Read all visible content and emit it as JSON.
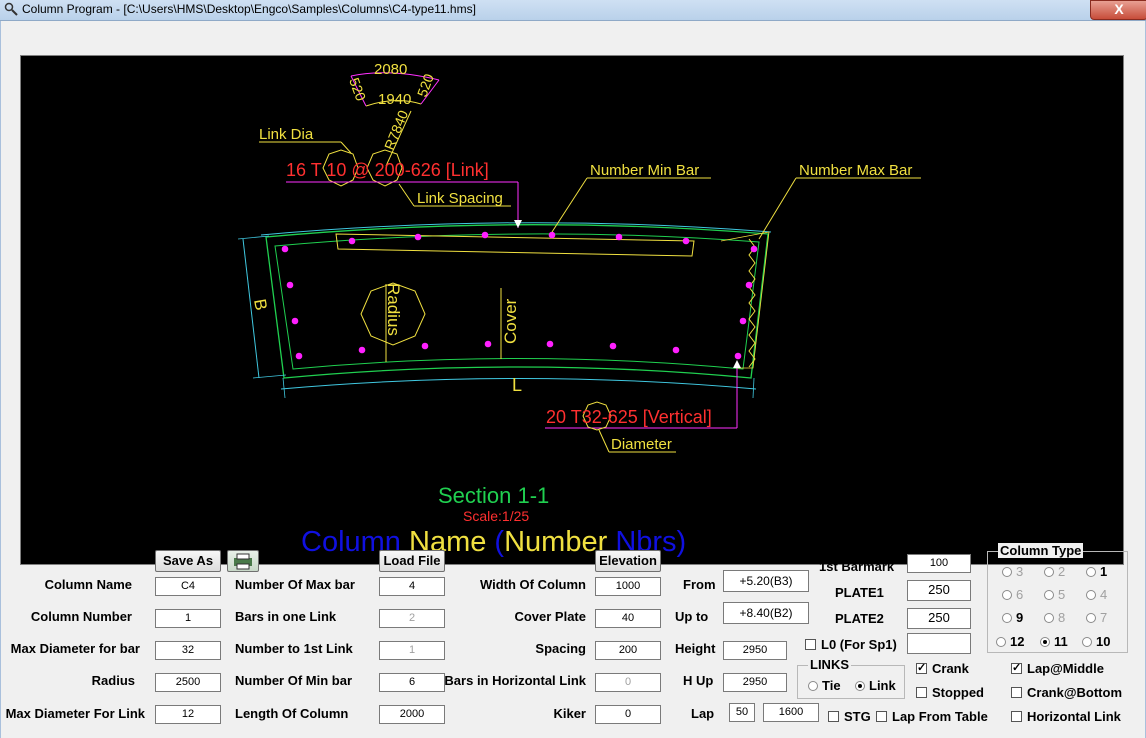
{
  "window": {
    "title": "Column Program - [C:\\Users\\HMS\\Desktop\\Engco\\Samples\\Columns\\C4-type11.hms]",
    "close_label": "X"
  },
  "drawing": {
    "dim_2080": "2080",
    "dim_1940": "1940",
    "dim_520a": "520",
    "dim_520b": "520",
    "dim_r7840": "R7840",
    "link_dia": "Link Dia",
    "link_text": "16 T 10 @ 200-626 [Link]",
    "link_spacing": "Link Spacing",
    "number_min_bar": "Number Min Bar",
    "number_max_bar": "Number Max Bar",
    "b_label": "B",
    "radius_label": "Radius",
    "cover_label": "Cover",
    "l_label": "L",
    "vertical_text": "20 T32-625 [Vertical]",
    "diameter_label": "Diameter",
    "section_title": "Section 1-1",
    "scale": "Scale:1/25",
    "name_line": {
      "w1": "Column",
      "w2": "Name",
      "p1": "(",
      "w3": "Number",
      "w4": "Nbrs",
      "p2": ")"
    }
  },
  "buttons": {
    "save_as": "Save As",
    "load_file": "Load File",
    "elevation": "Elevation"
  },
  "left_fields": [
    {
      "label": "Column Name",
      "value": "C4"
    },
    {
      "label": "Column Number",
      "value": "1"
    },
    {
      "label": "Max Diameter for bar",
      "value": "32"
    },
    {
      "label": "Radius",
      "value": "2500"
    },
    {
      "label": "Max Diameter For Link",
      "value": "12"
    }
  ],
  "mid_fields": [
    {
      "label": "Number Of Max bar",
      "value": "4"
    },
    {
      "label": "Bars in one Link",
      "value": "2"
    },
    {
      "label": "Number to 1st Link",
      "value": "1"
    },
    {
      "label": "Number Of Min bar",
      "value": "6"
    },
    {
      "label": "Length Of Column",
      "value": "2000"
    }
  ],
  "right_fields": [
    {
      "label": "Width Of Column",
      "value": "1000"
    },
    {
      "label": "Cover Plate",
      "value": "40"
    },
    {
      "label": "Spacing",
      "value": "200"
    },
    {
      "label": "Bars in Horizontal Link",
      "value": "0"
    },
    {
      "label": "Kiker",
      "value": "0"
    }
  ],
  "level_fields": {
    "from_label": "From",
    "from_value": "+5.20(B3)",
    "upto_label": "Up to",
    "upto_value": "+8.40(B2)",
    "height_label": "Height",
    "height_value": "2950",
    "hup_label": "H Up",
    "hup_value": "2950",
    "lap_label": "Lap",
    "lap_value1": "50",
    "lap_value2": "1600"
  },
  "barmark": {
    "first_label": "1st Barmark",
    "first_value": "100",
    "plate1_label": "PLATE1",
    "plate1_value": "250",
    "plate2_label": "PLATE2",
    "plate2_value": "250",
    "l0_label": "L0 (For Sp1)",
    "l0_value": ""
  },
  "links_group": {
    "title": "LINKS",
    "tie": "Tie",
    "link": "Link",
    "selected": "Link"
  },
  "checks": {
    "crank": "Crank",
    "stopped": "Stopped",
    "stg": "STG",
    "lap_from_table": "Lap From Table",
    "lap_middle": "Lap@Middle",
    "crank_bottom": "Crank@Bottom",
    "horizontal_link": "Horizontal Link"
  },
  "column_type": {
    "title": "Column Type",
    "options": [
      "3",
      "2",
      "1",
      "6",
      "5",
      "4",
      "9",
      "8",
      "7",
      "12",
      "11",
      "10"
    ],
    "selected": "11"
  },
  "colors": {
    "canvas": "#000000",
    "outline": "#20d050",
    "dims": "#40c8e0",
    "annot": "#f0e040",
    "red": "#ff3030",
    "bar": "#ff20ff",
    "blue": "#1010e0"
  }
}
